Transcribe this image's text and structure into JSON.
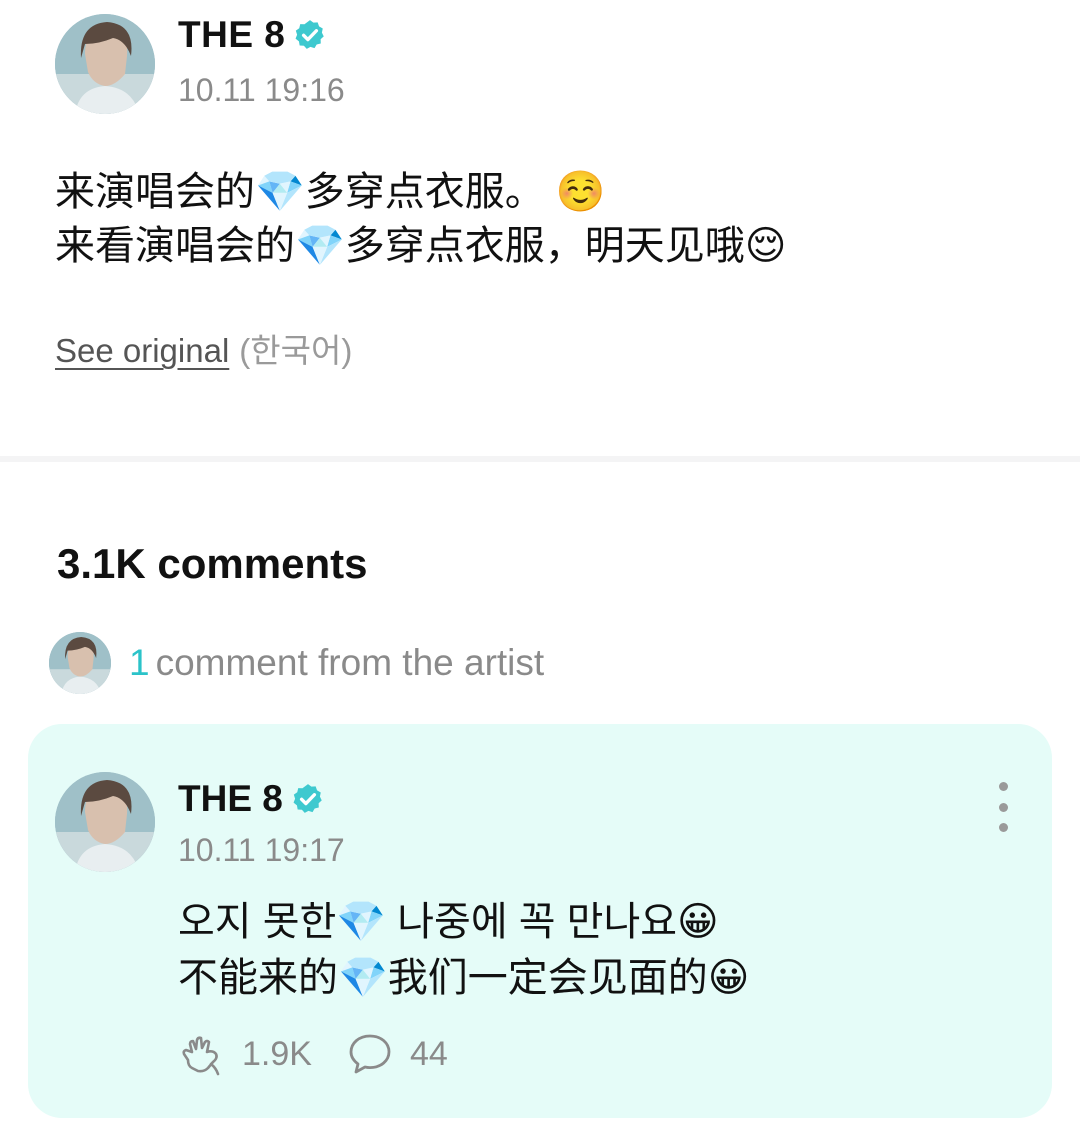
{
  "post": {
    "author": "THE 8",
    "verified_icon": "verified-badge-icon",
    "time": "10.11 19:16",
    "body": "来演唱会的💎多穿点衣服。 ☺️\n来看演唱会的💎多穿点衣服，明天见哦😌",
    "see_original_label": "See original",
    "see_original_lang": "(한국어)"
  },
  "comments": {
    "count_label": "3.1K comments",
    "artist_summary": {
      "count": "1",
      "label": "comment from the artist"
    },
    "items": [
      {
        "author": "THE 8",
        "time": "10.11 19:17",
        "body": "오지 못한💎 나중에 꼭 만나요😀\n不能来的💎我们一定会见面的😀",
        "likes": "1.9K",
        "replies": "44"
      }
    ]
  },
  "colors": {
    "accent": "#2bc3c9",
    "card_background": "#e5fcf8",
    "verified": "#3ec9cf"
  }
}
